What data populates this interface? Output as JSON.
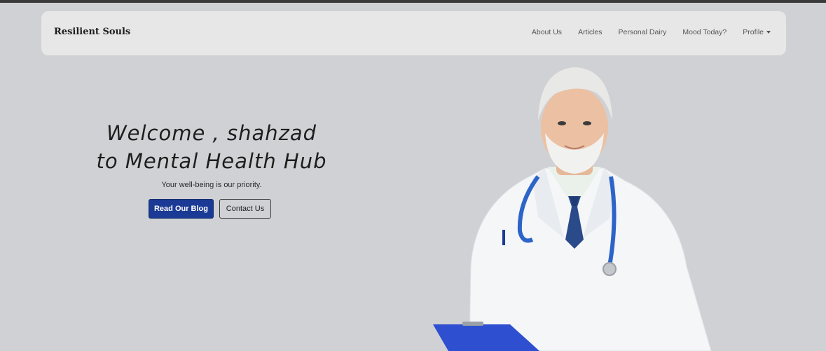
{
  "navbar": {
    "brand": "Resilient Souls",
    "links": [
      "About Us",
      "Articles",
      "Personal Dairy",
      "Mood Today?"
    ],
    "profile_label": "Profile"
  },
  "hero": {
    "title_line1": "Welcome , shahzad",
    "title_line2": "to Mental Health Hub",
    "subtitle": "Your well-being is our priority.",
    "primary_button": "Read Our Blog",
    "secondary_button": "Contact Us"
  },
  "colors": {
    "page_background": "#d0d1d4",
    "navbar_background": "#e7e7e7",
    "primary_button": "#1b3a95"
  }
}
